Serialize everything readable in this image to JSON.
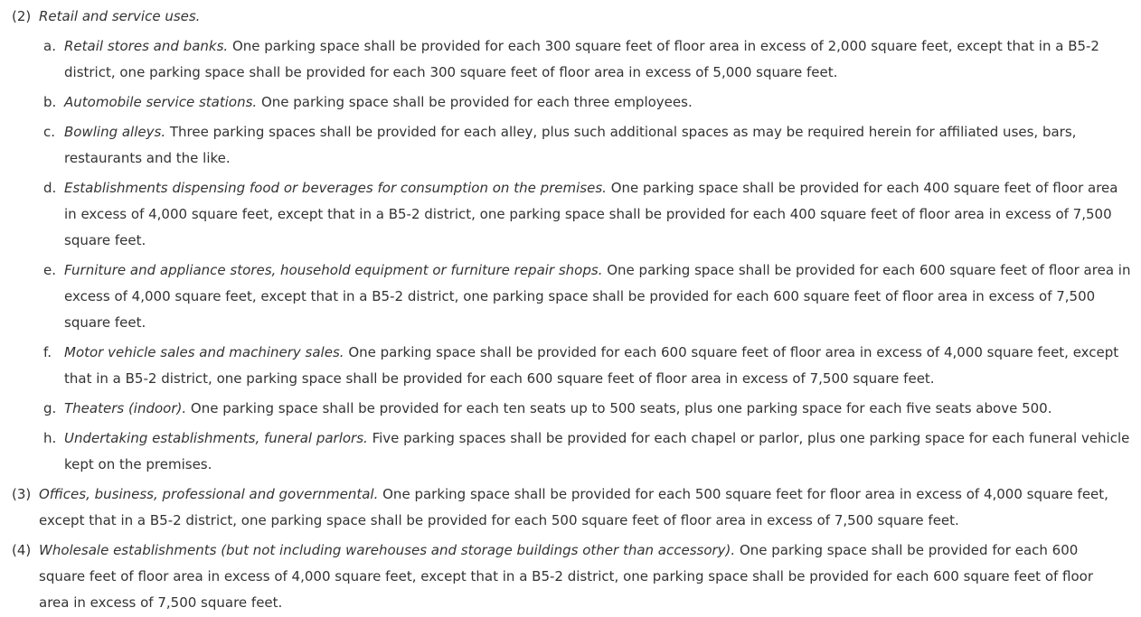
{
  "sections": [
    {
      "num": "(2)",
      "heading": "Retail and service uses.",
      "subitems": [
        {
          "num": "a.",
          "heading": "Retail stores and banks.",
          "text": " One parking space shall be provided for each 300 square feet of floor area in excess of 2,000 square feet, except that in a B5-2 district, one parking space shall be provided for each 300 square feet of floor area in excess of 5,000 square feet."
        },
        {
          "num": "b.",
          "heading": "Automobile service stations.",
          "text": " One parking space shall be provided for each three employees."
        },
        {
          "num": "c.",
          "heading": "Bowling alleys.",
          "text": " Three parking spaces shall be provided for each alley, plus such additional spaces as may be required herein for affiliated uses, bars, restaurants and the like."
        },
        {
          "num": "d.",
          "heading": "Establishments dispensing food or beverages for consumption on the premises.",
          "text": " One parking space shall be provided for each 400 square feet of floor area in excess of 4,000 square feet, except that in a B5-2 district, one parking space shall be provided for each 400 square feet of floor area in excess of 7,500 square feet."
        },
        {
          "num": "e.",
          "heading": "Furniture and appliance stores, household equipment or furniture repair shops.",
          "text": " One parking space shall be provided for each 600 square feet of floor area in excess of 4,000 square feet, except that in a B5-2 district, one parking space shall be provided for each 600 square feet of floor area in excess of 7,500 square feet."
        },
        {
          "num": "f.",
          "heading": "Motor vehicle sales and machinery sales.",
          "text": " One parking space shall be provided for each 600 square feet of floor area in excess of 4,000 square feet, except that in a B5-2 district, one parking space shall be provided for each 600 square feet of floor area in excess of 7,500 square feet."
        },
        {
          "num": "g.",
          "heading": "Theaters (indoor).",
          "text": " One parking space shall be provided for each ten seats up to 500 seats, plus one parking space for each five seats above 500."
        },
        {
          "num": "h.",
          "heading": "Undertaking establishments, funeral parlors.",
          "text": " Five parking spaces shall be provided for each chapel or parlor, plus one parking space for each funeral vehicle kept on the premises."
        }
      ]
    },
    {
      "num": "(3)",
      "heading": "Offices, business, professional and governmental.",
      "text": " One parking space shall be provided for each 500 square feet for floor area in excess of 4,000 square feet, except that in a B5-2 district, one parking space shall be provided for each 500 square feet of floor area in excess of 7,500 square feet."
    },
    {
      "num": "(4)",
      "heading": "Wholesale establishments (but not including warehouses and storage buildings other than accessory).",
      "text": " One parking space shall be provided for each 600 square feet of floor area in excess of 4,000 square feet, except that in a B5-2 district, one parking space shall be provided for each 600 square feet of floor area in excess of 7,500 square feet."
    }
  ]
}
